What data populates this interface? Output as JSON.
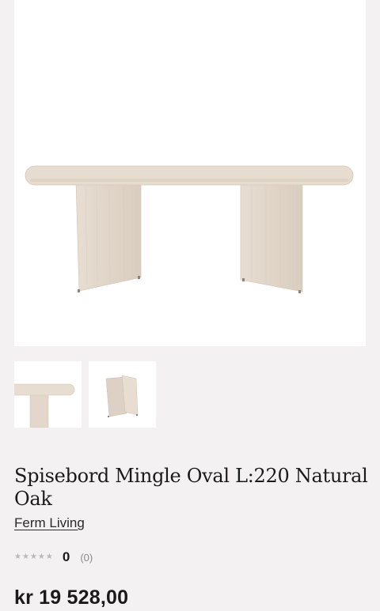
{
  "product": {
    "title": "Spisebord Mingle Oval L:220 Natural Oak",
    "brand": "Ferm Living",
    "rating": {
      "stars_filled": 0,
      "stars_total": 5,
      "value": "0",
      "review_count": "(0)"
    },
    "price": "kr 19 528,00"
  },
  "gallery": {
    "main_image": "oval-dining-table-image",
    "thumbnails": [
      {
        "name": "table-top-thumbnail"
      },
      {
        "name": "table-legs-thumbnail"
      }
    ]
  },
  "colors": {
    "background": "#f3f1f2",
    "wood": "#e4d9cc",
    "text": "#1a1a1a",
    "star_empty": "#b9b9b9"
  }
}
